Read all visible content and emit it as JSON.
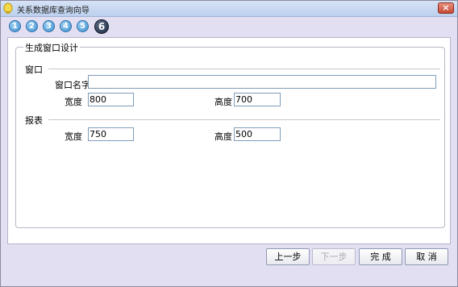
{
  "window": {
    "title": "关系数据库查询向导",
    "close_label": "×"
  },
  "steps": [
    "1",
    "2",
    "3",
    "4",
    "5",
    "6"
  ],
  "group": {
    "legend": "生成窗口设计",
    "window_section": "窗口",
    "window_name_label": "窗口名字",
    "window_name_value": "",
    "width_label": "宽度",
    "width_value": "800",
    "height_label": "高度",
    "height_value": "700",
    "report_section": "报表",
    "report_width_label": "宽度",
    "report_width_value": "750",
    "report_height_label": "高度",
    "report_height_value": "500"
  },
  "buttons": {
    "prev": "上一步",
    "next": "下一步",
    "finish": "完 成",
    "cancel": "取 消"
  }
}
